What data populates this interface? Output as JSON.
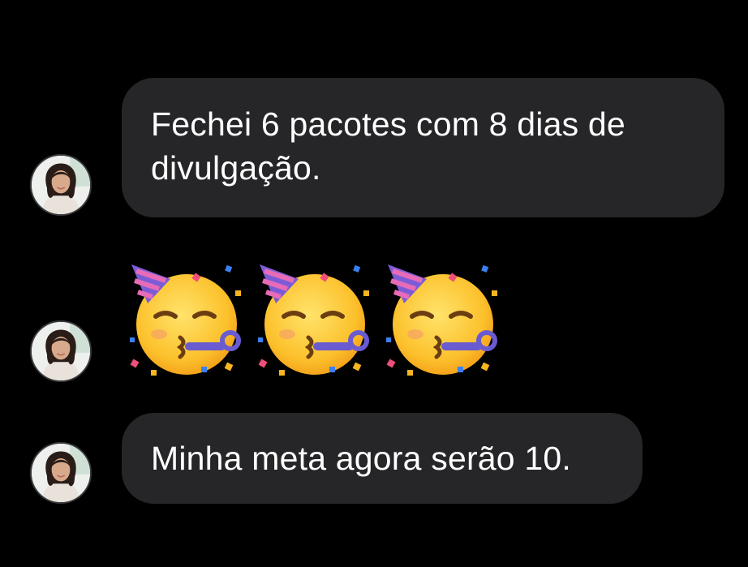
{
  "conversation": {
    "messages": [
      {
        "type": "text",
        "text": "Fechei 6 pacotes com 8 dias de divulgação."
      },
      {
        "type": "emoji",
        "emojis": [
          "partying-face-emoji",
          "partying-face-emoji",
          "partying-face-emoji"
        ]
      },
      {
        "type": "text",
        "text": "Minha meta agora serão 10."
      }
    ]
  },
  "colors": {
    "background": "#000000",
    "bubble": "#262628",
    "text": "#ffffff",
    "avatar_border": "#3a3a3c"
  }
}
